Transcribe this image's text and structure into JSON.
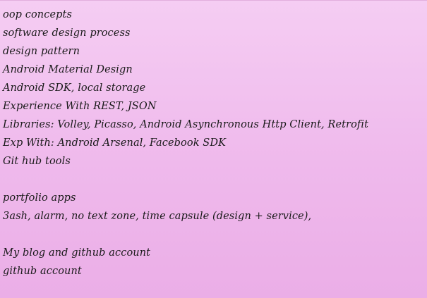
{
  "note": {
    "lines": [
      "oop concepts",
      "software design process",
      "design pattern",
      "Android Material Design",
      "Android SDK, local storage",
      "Experience With REST, JSON",
      "Libraries: Volley, Picasso, Android Asynchronous Http Client, Retrofit",
      "Exp With: Android Arsenal, Facebook SDK",
      "Git hub tools",
      "",
      "portfolio apps",
      "3ash, alarm, no text zone, time capsule (design + service),",
      "",
      "My blog and github account",
      "github account"
    ]
  }
}
